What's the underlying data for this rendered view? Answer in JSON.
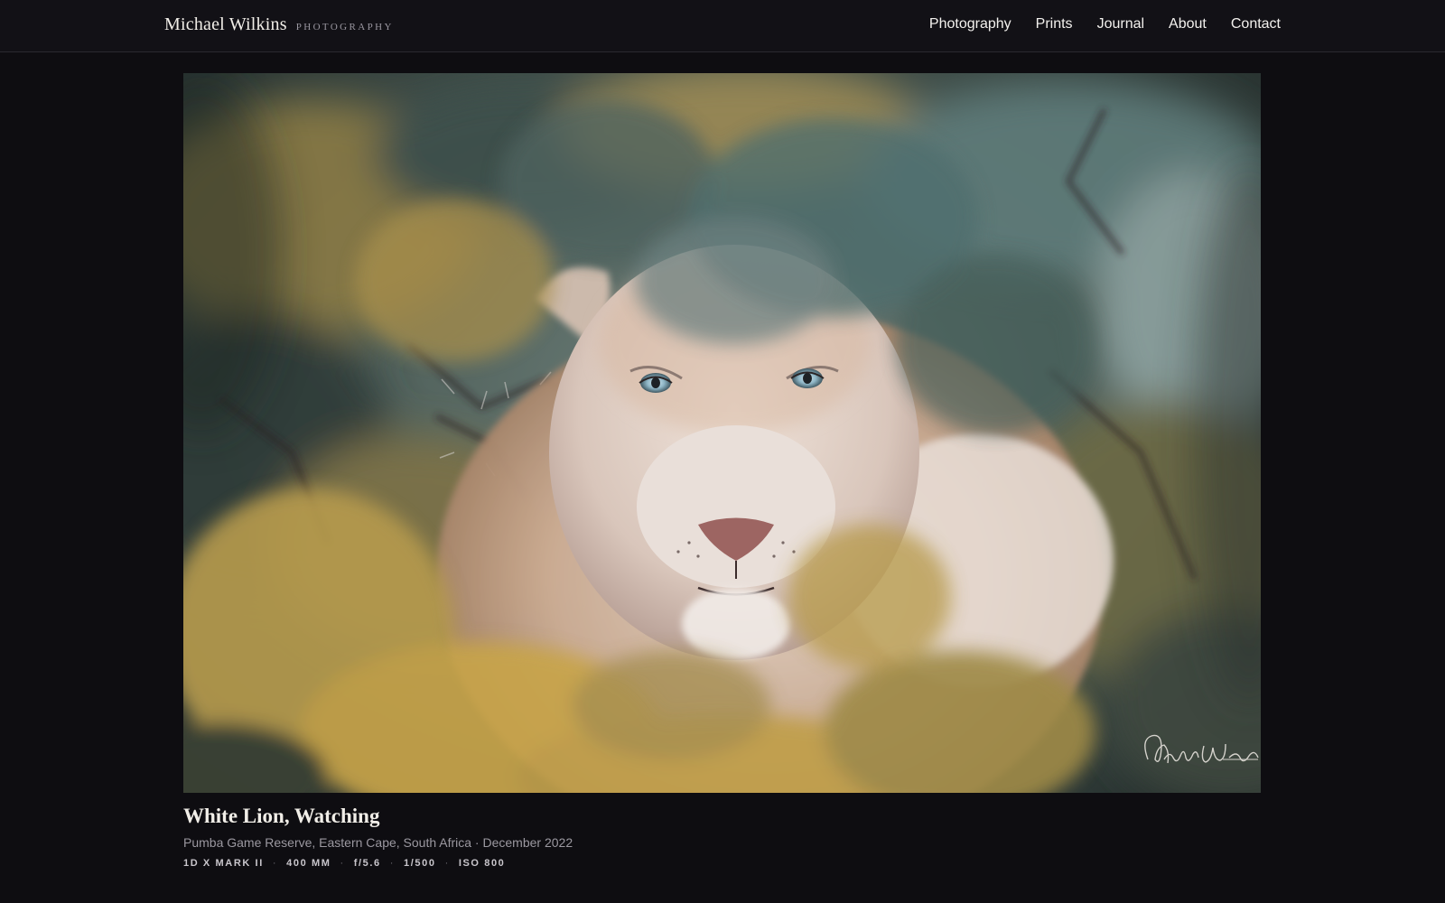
{
  "header": {
    "brand_name": "Michael Wilkins",
    "brand_sub": "PHOTOGRAPHY",
    "nav": [
      {
        "label": "Photography"
      },
      {
        "label": "Prints"
      },
      {
        "label": "Journal"
      },
      {
        "label": "About"
      },
      {
        "label": "Contact"
      }
    ]
  },
  "photo": {
    "subject": "white lion peering through bush",
    "signature": "Michael Wilkins"
  },
  "caption": {
    "title": "White Lion, Watching",
    "location": "Pumba Game Reserve, Eastern Cape, South Africa · December 2022",
    "exif": {
      "camera": "1D X MARK II",
      "focal": "400 MM",
      "aperture": "f/5.6",
      "shutter": "1/500",
      "iso": "ISO 800",
      "separator": "·"
    }
  },
  "colors": {
    "background": "#0e0d11",
    "header": "#121116",
    "foliage_gold": "#b59a4e",
    "foliage_teal": "#4f6e6e"
  }
}
